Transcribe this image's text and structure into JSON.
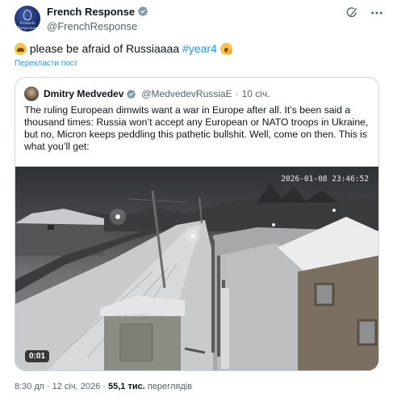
{
  "post": {
    "author": {
      "display_name": "French Response",
      "handle": "@FrenchResponse",
      "avatar_text": "French Response"
    },
    "text_part1": " please be afraid of Russiaaaa ",
    "hashtag": "#year4",
    "emoji_start": "weary-face",
    "emoji_end": "yawning-face",
    "translate_label": "Перекласти пост",
    "time": "8:30 дп",
    "date": "12 січ. 2026",
    "views_count": "55,1 тис.",
    "views_label": "переглядів",
    "separator": "·"
  },
  "quoted": {
    "display_name": "Dmitry Medvedev",
    "handle": "@MedvedevRussiaE",
    "separator": "·",
    "date": "10 січ.",
    "text": "The ruling European dimwits want a war in Europe after all. It’s been said a thousand times: Russia won’t accept any European or NATO troops in Ukraine, but no, Micron keeps peddling this pathetic bullshit. Well, come on then. This is what you’ll get:",
    "video": {
      "timestamp": "2026-01-08 23:46:52",
      "duration": "0:01"
    }
  },
  "colors": {
    "accent": "#1d9bf0",
    "secondary_text": "#536471",
    "border": "#cfd9de"
  },
  "icons": [
    "verified-badge-icon",
    "grok-icon",
    "more-icon"
  ]
}
